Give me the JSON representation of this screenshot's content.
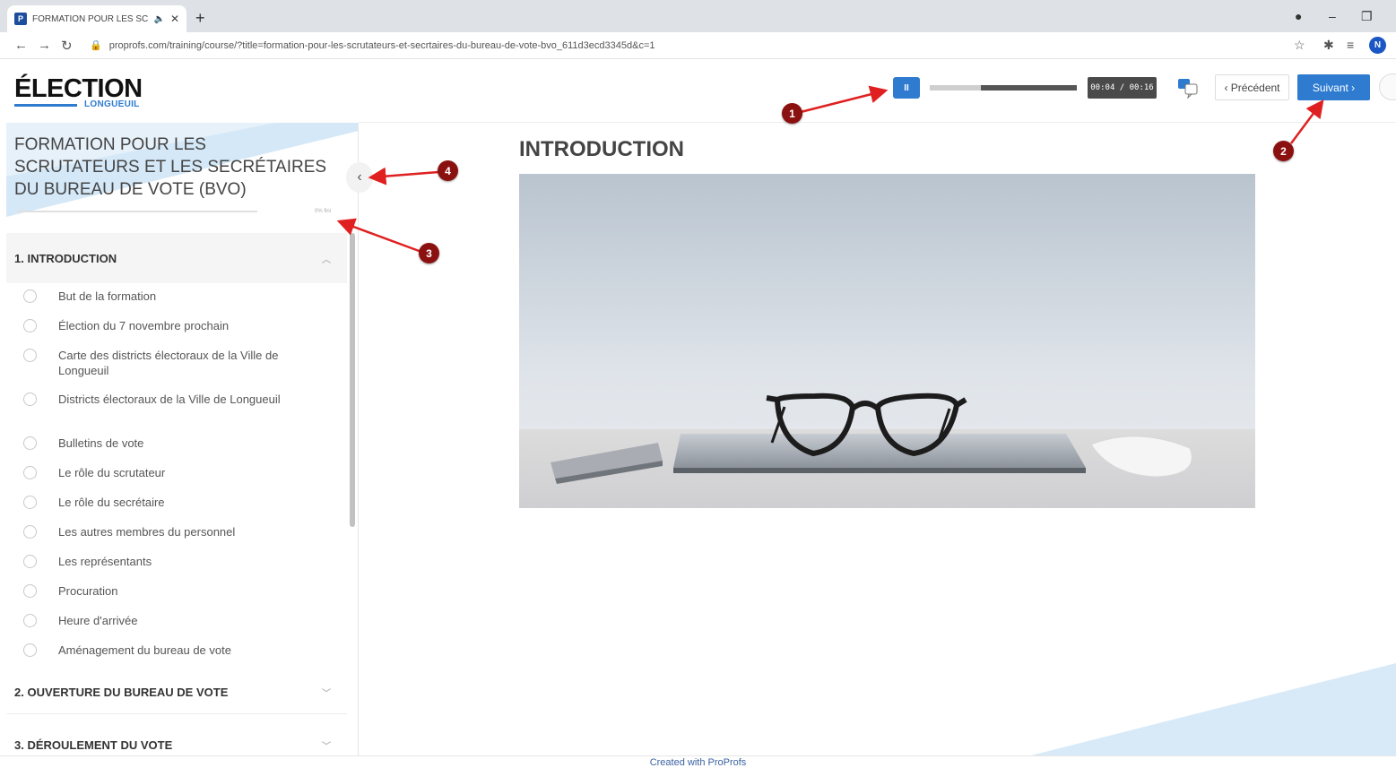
{
  "browser": {
    "tab_title": "FORMATION POUR LES SCR",
    "favicon_text": "P",
    "new_tab": "+",
    "url": "proprofs.com/training/course/?title=formation-pour-les-scrutateurs-et-secrtaires-du-bureau-de-vote-bvo_611d3ecd3345d&c=1",
    "profile_initial": "N"
  },
  "logo": {
    "word": "ÉLECTION",
    "sub": "LONGUEUIL"
  },
  "player": {
    "pause_label": "II",
    "progress": 0.35,
    "time": "00:04 / 00:16"
  },
  "nav": {
    "prev_label": "‹  Précédent",
    "next_label": "Suivant  ›"
  },
  "course": {
    "title": "FORMATION POUR LES SCRUTATEURS ET LES SECRÉTAIRES DU BUREAU DE VOTE (BVO)",
    "progress_pct": "0% fini"
  },
  "sections": [
    {
      "label": "1.  INTRODUCTION",
      "lessons": [
        "But de la formation",
        "Élection du 7 novembre prochain",
        "Carte des districts électoraux de la Ville de Longueuil",
        "Districts électoraux de la Ville de Longueuil",
        "Bulletins de vote",
        "Le rôle du scrutateur",
        "Le rôle du secrétaire",
        "Les autres membres du personnel",
        "Les représentants",
        "Procuration",
        "Heure d'arrivée",
        "Aménagement du bureau de vote"
      ]
    },
    {
      "label": "2.  OUVERTURE DU BUREAU DE VOTE"
    },
    {
      "label": "3.  DÉROULEMENT DU VOTE"
    }
  ],
  "content": {
    "title": "INTRODUCTION"
  },
  "footer": "Created with ProProfs",
  "annotations": [
    "1",
    "2",
    "3",
    "4"
  ],
  "colors": {
    "accent": "#2e7bd0",
    "annotation": "#8b1111",
    "arrow": "#e02020"
  }
}
